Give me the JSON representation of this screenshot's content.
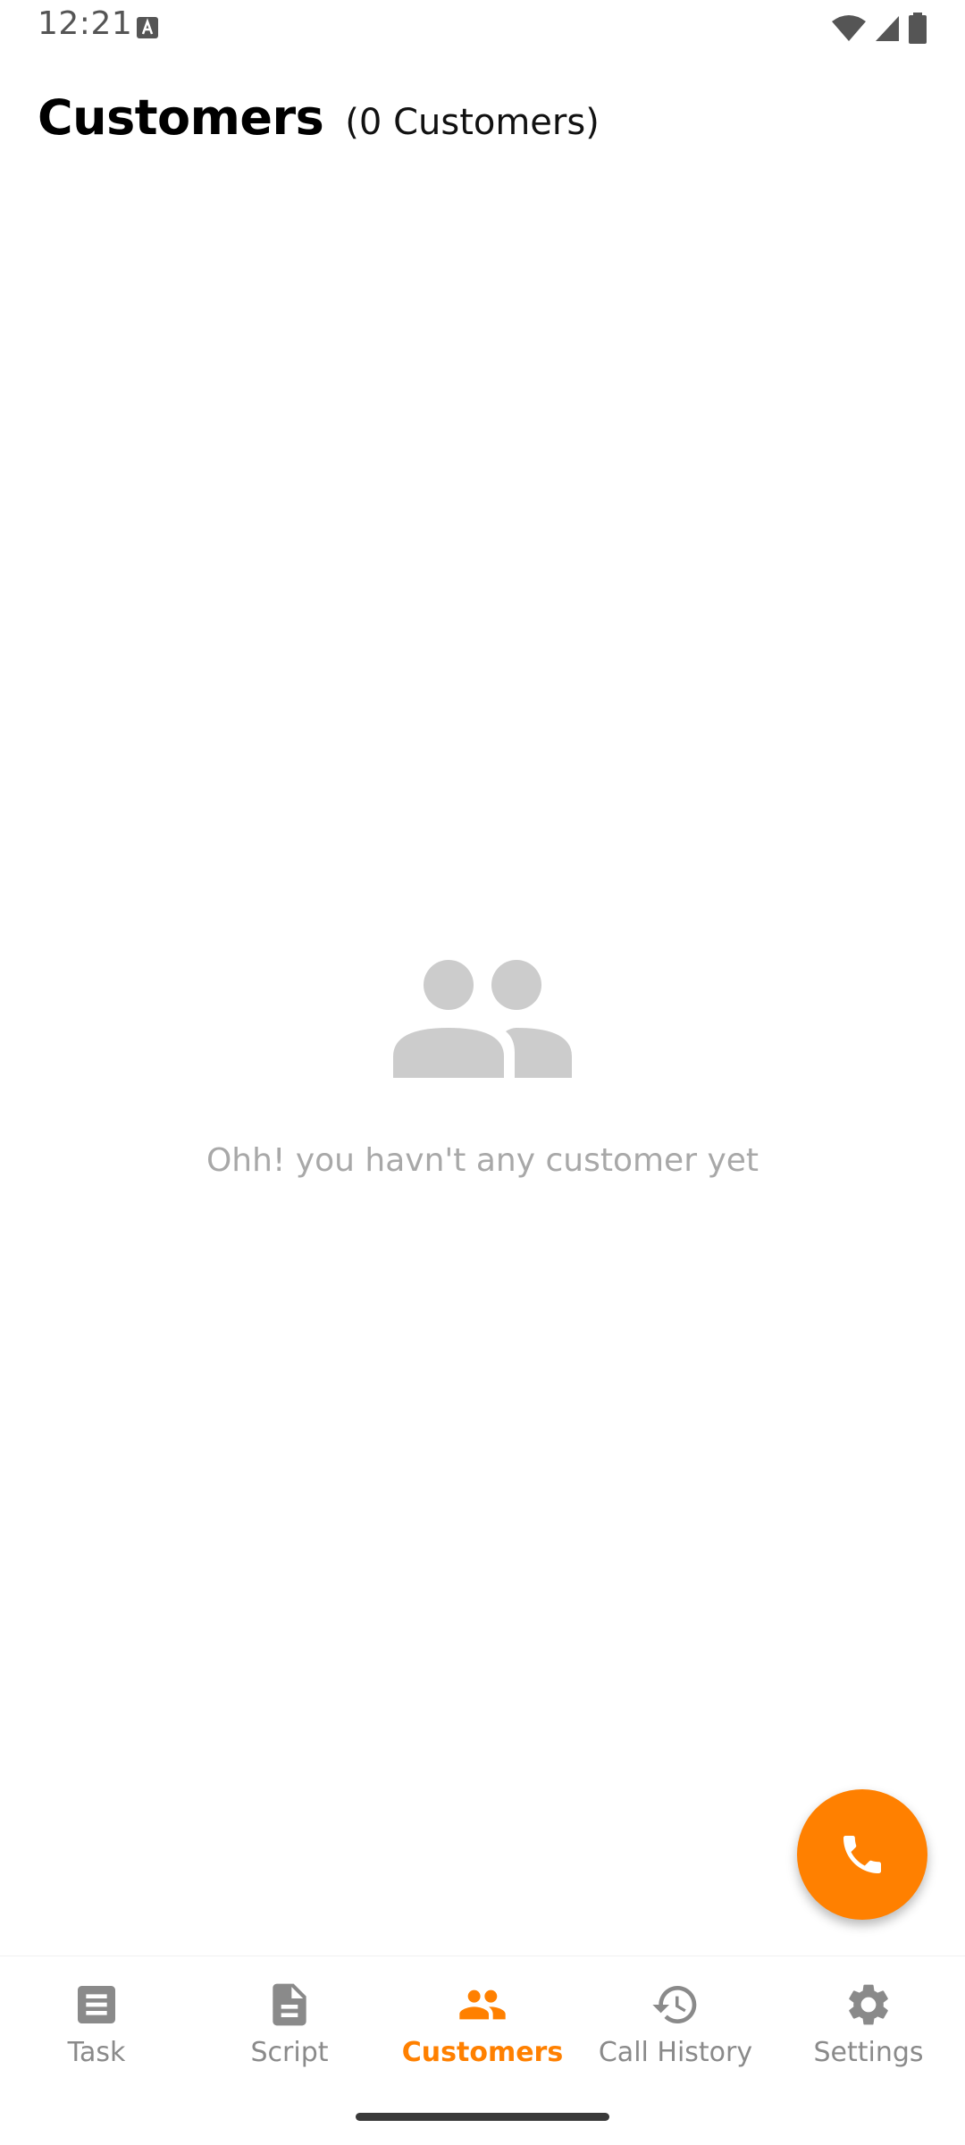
{
  "status_bar": {
    "time": "12:21",
    "icons": [
      "text-notification-icon",
      "wifi-icon",
      "cellular-signal-icon",
      "battery-icon"
    ]
  },
  "header": {
    "title": "Customers",
    "count": "(0 Customers)"
  },
  "empty_state": {
    "icon": "people-icon",
    "message": "Ohh! you havn't any customer yet"
  },
  "fab": {
    "icon": "phone-icon"
  },
  "bottom_nav": {
    "items": [
      {
        "label": "Task",
        "icon": "task-list-icon",
        "active": false
      },
      {
        "label": "Script",
        "icon": "document-icon",
        "active": false
      },
      {
        "label": "Customers",
        "icon": "people-icon",
        "active": true
      },
      {
        "label": "Call History",
        "icon": "history-icon",
        "active": false
      },
      {
        "label": "Settings",
        "icon": "gear-icon",
        "active": false
      }
    ]
  },
  "colors": {
    "accent": "#ff8000",
    "inactive": "#8a8a8a",
    "empty_icon": "#cccccc",
    "empty_text": "#a8a8a8"
  }
}
